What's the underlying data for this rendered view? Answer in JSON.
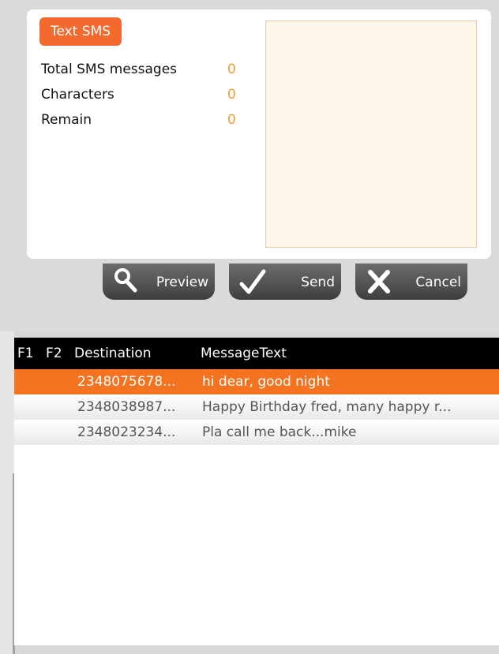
{
  "sms_panel": {
    "badge": "Text SMS",
    "stats": [
      {
        "label": "Total SMS messages",
        "value": "0"
      },
      {
        "label": "Characters",
        "value": "0"
      },
      {
        "label": "Remain",
        "value": "0"
      }
    ],
    "message_placeholder": ""
  },
  "buttons": {
    "preview": "Preview",
    "send": "Send",
    "cancel": "Cancel"
  },
  "grid": {
    "headers": [
      "F1",
      "F2",
      "Destination",
      "MessageText"
    ],
    "rows": [
      {
        "destination": "2348075678...",
        "text": "hi dear, good night",
        "selected": true
      },
      {
        "destination": "2348038987...",
        "text": "Happy Birthday fred, many happy r...",
        "selected": false
      },
      {
        "destination": "2348023234...",
        "text": "Pla call me back...mike",
        "selected": false
      }
    ]
  },
  "colors": {
    "accent": "#f47320",
    "stat_value": "#f39a2a"
  }
}
